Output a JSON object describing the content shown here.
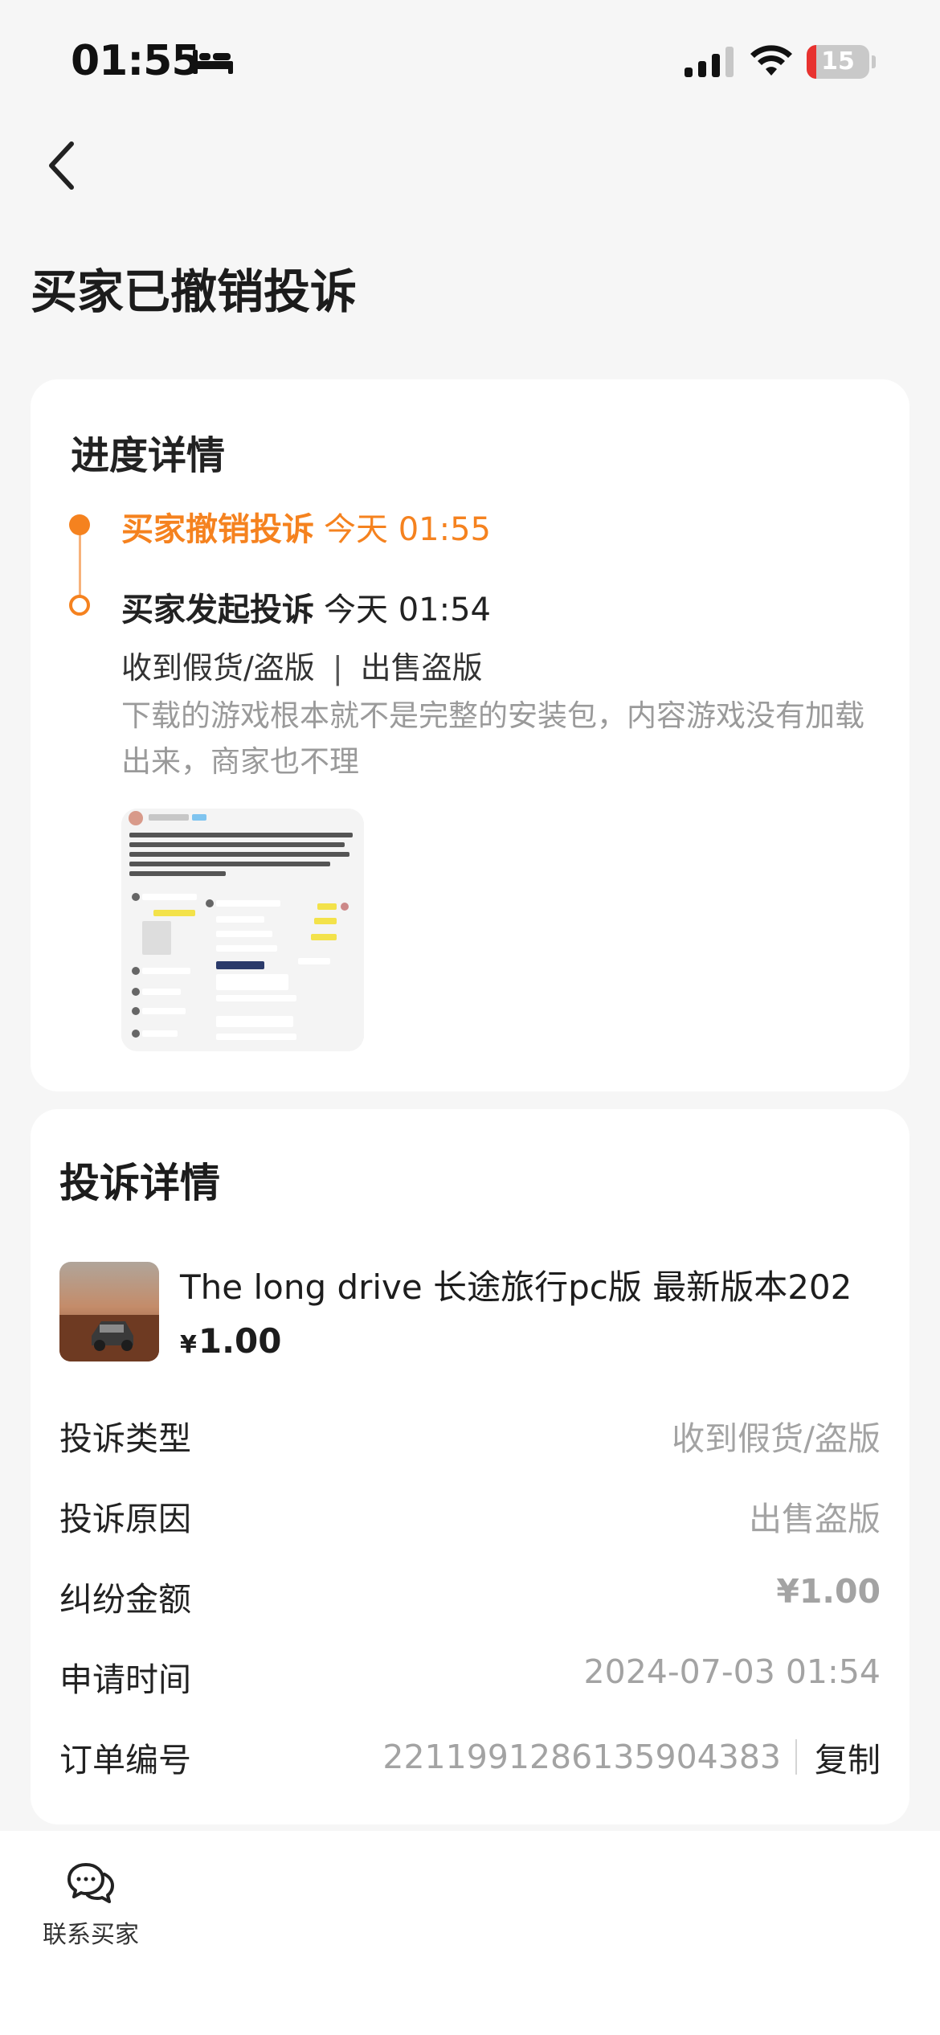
{
  "status_bar": {
    "time": "01:55",
    "battery_level": "15",
    "battery_fraction": 0.15,
    "icons": [
      "bed-icon",
      "signal-icon",
      "wifi-icon",
      "battery-icon"
    ]
  },
  "header": {
    "back_icon": "chevron-left-icon",
    "title": "买家已撤销投诉"
  },
  "progress": {
    "title": "进度详情",
    "steps": [
      {
        "title": "买家撤销投诉",
        "time": "今天 01:55",
        "color": "#F5821F"
      },
      {
        "title": "买家发起投诉",
        "time": "今天 01:54",
        "type": "收到假货/盗版",
        "separator": "|",
        "reason": "出售盗版",
        "description": "下载的游戏根本就不是完整的安装包，内容游戏没有加载出来，商家也不理"
      }
    ],
    "evidence_image": "chat-screenshot-image"
  },
  "detail": {
    "title": "投诉详情",
    "product": {
      "name": "The long drive 长途旅行pc版 最新版本202",
      "currency": "¥",
      "price": "1.00",
      "thumbnail": "product-thumbnail-image"
    },
    "rows": [
      {
        "label": "投诉类型",
        "value": "收到假货/盗版"
      },
      {
        "label": "投诉原因",
        "value": "出售盗版"
      },
      {
        "label": "纠纷金额",
        "value": "¥1.00"
      },
      {
        "label": "申请时间",
        "value": "2024-07-03 01:54"
      },
      {
        "label": "订单编号",
        "value": "2211991286135904383",
        "action": "复制"
      }
    ]
  },
  "bottom_bar": {
    "contact_icon": "chat-bubbles-icon",
    "contact_label": "联系买家"
  },
  "colors": {
    "accent": "#F5821F",
    "background": "#F6F6F6",
    "card": "#FFFFFF",
    "muted_text": "#A3A3A3"
  }
}
